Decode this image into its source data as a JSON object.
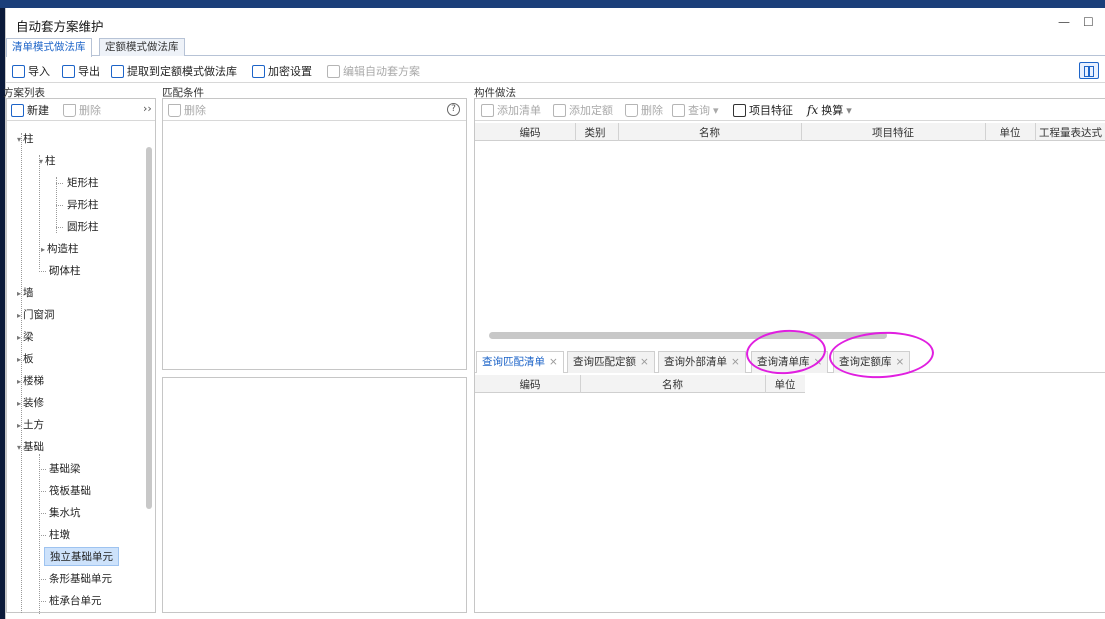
{
  "window": {
    "title": "自动套方案维护",
    "minimize": "—",
    "maximize": "☐"
  },
  "tabs": [
    {
      "label": "清单模式做法库"
    },
    {
      "label": "定额模式做法库"
    }
  ],
  "toolbar": {
    "import": "导入",
    "export": "导出",
    "extract": "提取到定额模式做法库",
    "encrypt": "加密设置",
    "edit_auto": "编辑自动套方案"
  },
  "left": {
    "title": "方案列表",
    "new": "新建",
    "delete": "删除",
    "more": "››",
    "tree": [
      {
        "label": "柱",
        "expanded": true
      },
      {
        "label": "柱",
        "expanded": true
      },
      {
        "label": "矩形柱"
      },
      {
        "label": "异形柱"
      },
      {
        "label": "圆形柱"
      },
      {
        "label": "构造柱",
        "expanded": false
      },
      {
        "label": "砌体柱"
      },
      {
        "label": "墙"
      },
      {
        "label": "门窗洞"
      },
      {
        "label": "梁"
      },
      {
        "label": "板"
      },
      {
        "label": "楼梯"
      },
      {
        "label": "装修"
      },
      {
        "label": "土方"
      },
      {
        "label": "基础",
        "expanded": true
      },
      {
        "label": "基础梁"
      },
      {
        "label": "筏板基础"
      },
      {
        "label": "集水坑"
      },
      {
        "label": "柱墩"
      },
      {
        "label": "独立基础单元",
        "selected": true
      },
      {
        "label": "条形基础单元"
      },
      {
        "label": "桩承台单元"
      }
    ]
  },
  "middle": {
    "title": "匹配条件",
    "delete": "删除",
    "help": "?"
  },
  "right": {
    "title": "构件做法",
    "toolbar": {
      "add_list": "添加清单",
      "add_quota": "添加定额",
      "delete": "删除",
      "query": "查询",
      "item_feature": "项目特征",
      "convert": "换算"
    },
    "columns": [
      "编码",
      "类别",
      "名称",
      "项目特征",
      "单位",
      "工程量表达式"
    ],
    "query_tabs": [
      "查询匹配清单",
      "查询匹配定额",
      "查询外部清单",
      "查询清单库",
      "查询定额库"
    ],
    "query_columns": [
      "编码",
      "名称",
      "单位"
    ]
  },
  "colors": {
    "accent": "#1d64c8",
    "annotation": "#e01fe0",
    "selected": "#cde2fb"
  }
}
